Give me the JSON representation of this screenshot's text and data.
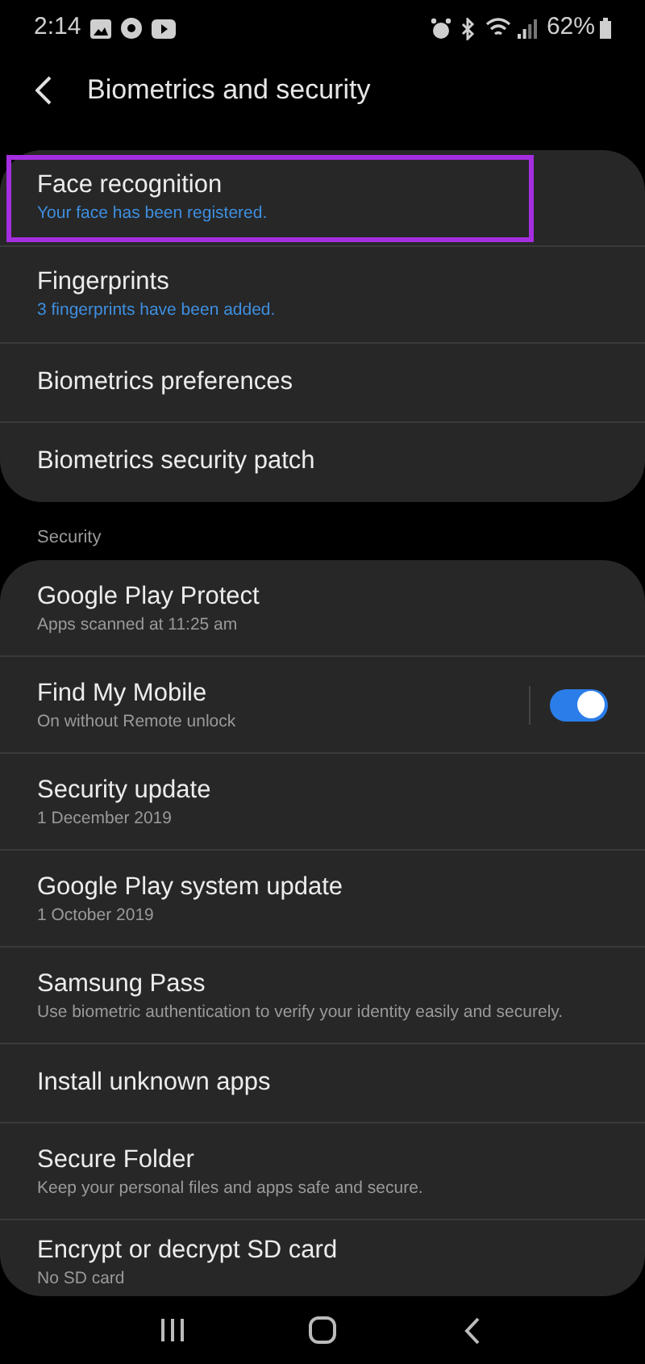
{
  "status_bar": {
    "time": "2:14",
    "battery": "62%"
  },
  "header": {
    "title": "Biometrics and security"
  },
  "groups": [
    {
      "items": [
        {
          "title": "Face recognition",
          "subtitle": "Your face has been registered.",
          "color": "#3e8fe0",
          "highlighted": true
        },
        {
          "title": "Fingerprints",
          "subtitle": "3 fingerprints have been added.",
          "color": "#3e8fe0",
          "highlighted": false
        },
        {
          "title": "Biometrics preferences",
          "highlighted": false
        },
        {
          "title": "Biometrics security patch",
          "highlighted": false
        }
      ]
    },
    {
      "label": "Security",
      "items": [
        {
          "title": "Google Play Protect",
          "subtitle": "Apps scanned at 11:25 am",
          "color": "#9a9a9a",
          "highlighted": false
        },
        {
          "title": "Find My Mobile",
          "subtitle": "On without Remote unlock",
          "color": "#9a9a9a",
          "toggle": {
            "on": true
          },
          "highlighted": false
        },
        {
          "title": "Security update",
          "subtitle": "1 December 2019",
          "color": "#9a9a9a",
          "highlighted": false
        },
        {
          "title": "Google Play system update",
          "subtitle": "1 October 2019",
          "color": "#9a9a9a",
          "highlighted": false
        },
        {
          "title": "Samsung Pass",
          "subtitle": "Use biometric authentication to verify your identity easily and securely.",
          "color": "#9a9a9a",
          "highlighted": false
        },
        {
          "title": "Install unknown apps",
          "highlighted": false
        },
        {
          "title": "Secure Folder",
          "subtitle": "Keep your personal files and apps safe and secure.",
          "color": "#9a9a9a",
          "highlighted": false
        },
        {
          "title": "Encrypt or decrypt SD card",
          "subtitle": "No SD card",
          "color": "#9a9a9a",
          "highlighted": false
        }
      ]
    }
  ]
}
